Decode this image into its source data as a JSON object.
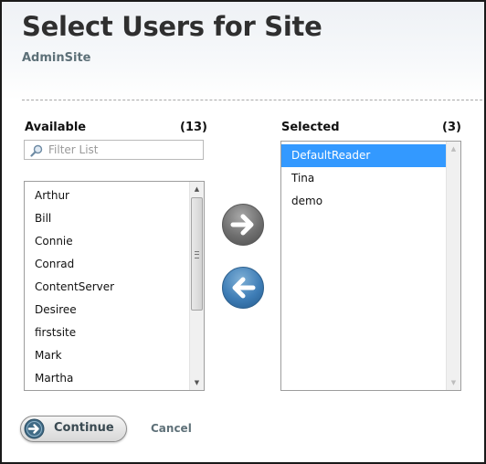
{
  "header": {
    "title": "Select Users for Site",
    "subtitle": "AdminSite"
  },
  "available": {
    "label": "Available",
    "count": "(13)",
    "filter_placeholder": "Filter List",
    "items": [
      "Arthur",
      "Bill",
      "Connie",
      "Conrad",
      "ContentServer",
      "Desiree",
      "firstsite",
      "Mark",
      "Martha"
    ]
  },
  "selected": {
    "label": "Selected",
    "count": "(3)",
    "items": [
      "DefaultReader",
      "Tina",
      "demo"
    ],
    "highlighted_index": 0
  },
  "actions": {
    "add_icon": "arrow-right-icon",
    "remove_icon": "arrow-left-icon",
    "continue_label": "Continue",
    "cancel_label": "Cancel"
  },
  "colors": {
    "highlight": "#3399ff",
    "subtitle": "#5d7078",
    "add_button": "#6f6f6f",
    "remove_button": "#3e7db6"
  }
}
